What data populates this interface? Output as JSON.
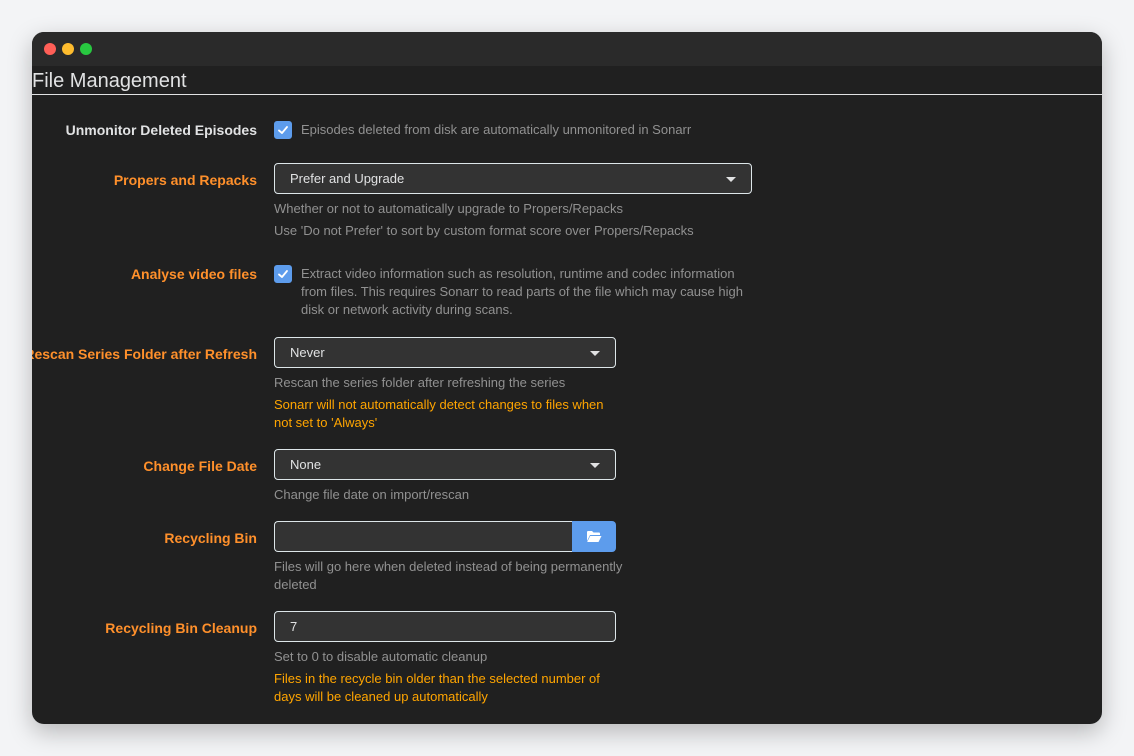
{
  "section": {
    "title": "File Management"
  },
  "unmonitor": {
    "label": "Unmonitor Deleted Episodes",
    "checked": true,
    "text": "Episodes deleted from disk are automatically unmonitored in Sonarr"
  },
  "propers": {
    "label": "Propers and Repacks",
    "value": "Prefer and Upgrade",
    "help1": "Whether or not to automatically upgrade to Propers/Repacks",
    "help2": "Use 'Do not Prefer' to sort by custom format score over Propers/Repacks"
  },
  "analyse": {
    "label": "Analyse video files",
    "checked": true,
    "line1": "Extract video information such as resolution, runtime and codec information",
    "line2": "from files. This requires Sonarr to read parts of the file which may cause high",
    "line3": "disk or network activity during scans."
  },
  "rescan": {
    "label": "Rescan Series Folder after Refresh",
    "value": "Never",
    "help": "Rescan the series folder after refreshing the series",
    "warn1": "Sonarr will not automatically detect changes to files when",
    "warn2": "not set to 'Always'"
  },
  "filedate": {
    "label": "Change File Date",
    "value": "None",
    "help": "Change file date on import/rescan"
  },
  "recycling": {
    "label": "Recycling Bin",
    "value": "",
    "help1": "Files will go here when deleted instead of being permanently",
    "help2": "deleted"
  },
  "cleanup": {
    "label": "Recycling Bin Cleanup",
    "value": "7",
    "help": "Set to 0 to disable automatic cleanup",
    "warn1": "Files in the recycle bin older than the selected number of",
    "warn2": "days will be cleaned up automatically"
  },
  "colors": {
    "accent": "#5d9cec",
    "label_orange": "#ff902b",
    "warning": "#ffa500",
    "background": "#202020"
  }
}
